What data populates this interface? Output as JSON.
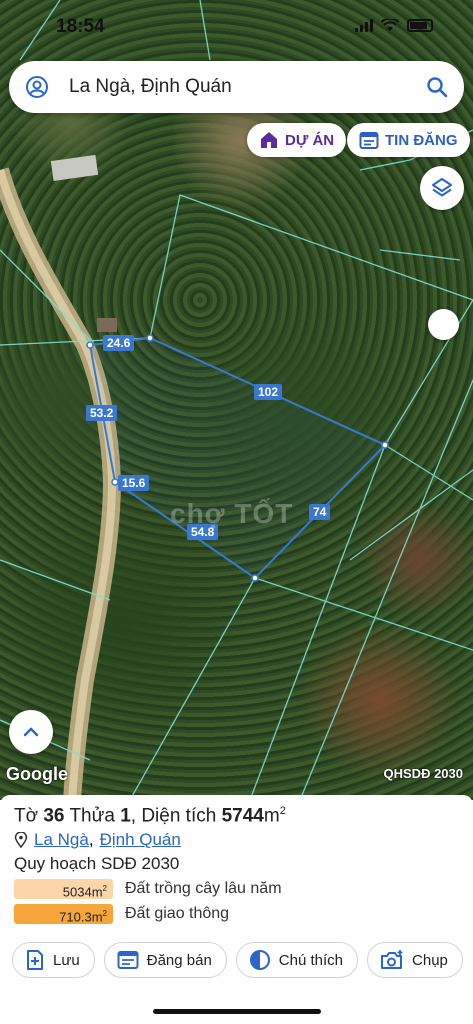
{
  "status": {
    "time": "18:54"
  },
  "search": {
    "text": "La Ngà, Định Quán",
    "user_icon": "user-circle-icon",
    "search_icon": "search-icon"
  },
  "top_pills": [
    {
      "label": "DỰ ÁN",
      "icon": "house-icon",
      "color": "#5a2c9e"
    },
    {
      "label": "TIN ĐĂNG",
      "icon": "calendar-list-icon",
      "color": "#2c5fc4"
    }
  ],
  "map": {
    "segments": [
      "24.6",
      "102",
      "53.2",
      "15.6",
      "54.8",
      "74"
    ],
    "watermark": "chợ TỐT",
    "logo": "Google",
    "source": "QHSDĐ 2030",
    "boundary_color": "#3a78d0",
    "cadastral_color": "#7fe0d0"
  },
  "parcel": {
    "prefix": "Tờ",
    "sheet_no": "36",
    "parcel_label": "Thửa",
    "parcel_no": "1",
    "area_label": "Diện tích",
    "area_value": "5744",
    "area_unit": "m",
    "area_sup": "2",
    "ward": "La Ngà",
    "district": "Định Quán",
    "separator": ","
  },
  "planning": {
    "title": "Quy hoạch SDĐ 2030",
    "items": [
      {
        "value": "5034m",
        "sup": "2",
        "label": "Đất trồng cây lâu năm",
        "color": "#fcd6a9"
      },
      {
        "value": "710.3m",
        "sup": "2",
        "label": "Đất giao thông",
        "color": "#f6a53a"
      }
    ]
  },
  "actions": [
    {
      "label": "Lưu",
      "icon": "bookmark-add-icon"
    },
    {
      "label": "Đăng bán",
      "icon": "listing-icon"
    },
    {
      "label": "Chú thích",
      "icon": "legend-icon"
    },
    {
      "label": "Chụp",
      "icon": "camera-add-icon"
    }
  ]
}
